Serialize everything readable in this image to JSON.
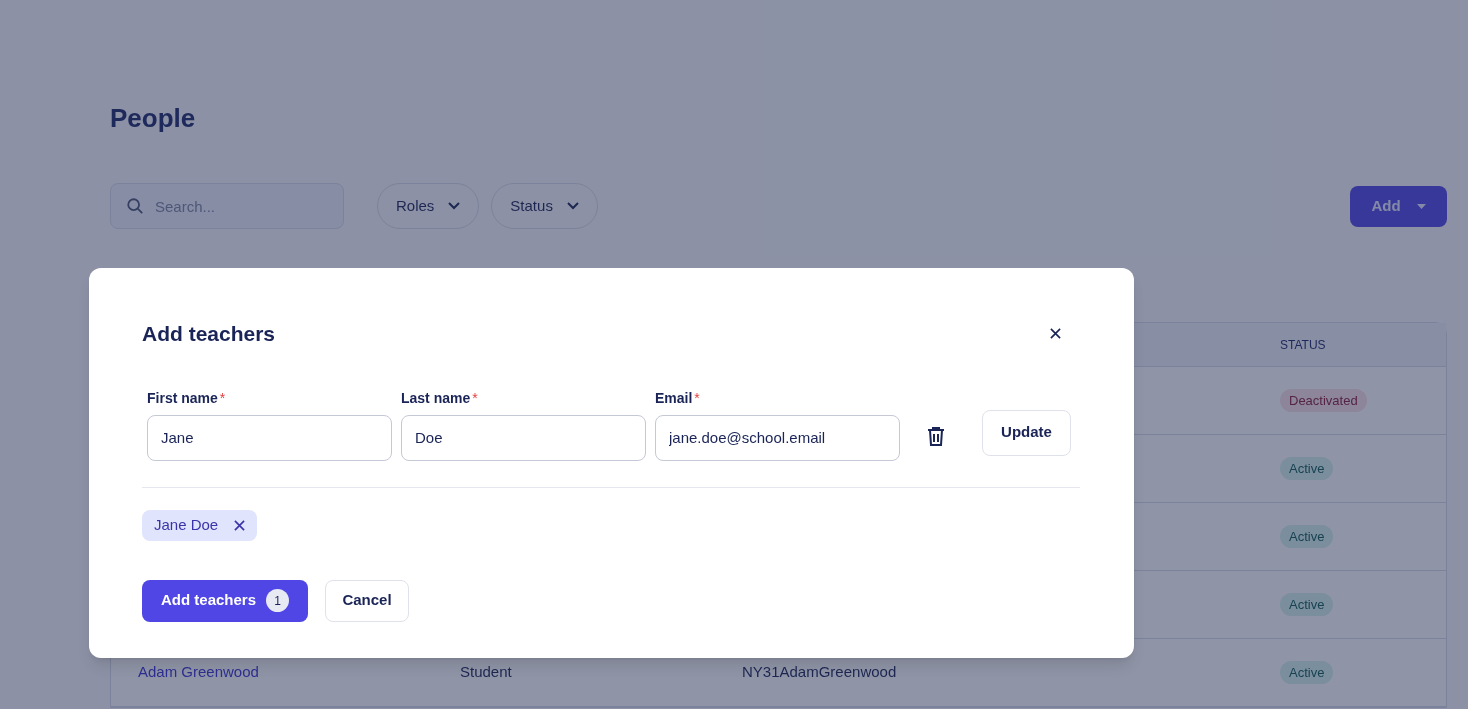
{
  "page": {
    "title": "People"
  },
  "toolbar": {
    "search": {
      "placeholder": "Search..."
    },
    "filters": [
      {
        "label": "Roles"
      },
      {
        "label": "Status"
      }
    ],
    "add_button": {
      "label": "Add"
    }
  },
  "table": {
    "columns": [
      {
        "label": "STATUS"
      }
    ],
    "rows": [
      {
        "status": {
          "label": "Deactivated",
          "kind": "deactivated"
        }
      },
      {
        "status": {
          "label": "Active",
          "kind": "active"
        }
      },
      {
        "status": {
          "label": "Active",
          "kind": "active"
        }
      },
      {
        "status": {
          "label": "Active",
          "kind": "active"
        }
      },
      {
        "name": "Adam Greenwood",
        "role": "Student",
        "username": "NY31AdamGreenwood",
        "status": {
          "label": "Active",
          "kind": "active"
        }
      }
    ]
  },
  "dialog": {
    "title": "Add teachers",
    "fields": [
      {
        "label": "First name",
        "required_mark": "*",
        "value": "Jane"
      },
      {
        "label": "Last name",
        "required_mark": "*",
        "value": "Doe"
      },
      {
        "label": "Email",
        "required_mark": "*",
        "value": "jane.doe@school.email"
      }
    ],
    "update_button": "Update",
    "chips": [
      {
        "label": "Jane Doe"
      }
    ],
    "primary_button": {
      "label": "Add teachers",
      "count": "1"
    },
    "cancel_button": "Cancel"
  }
}
